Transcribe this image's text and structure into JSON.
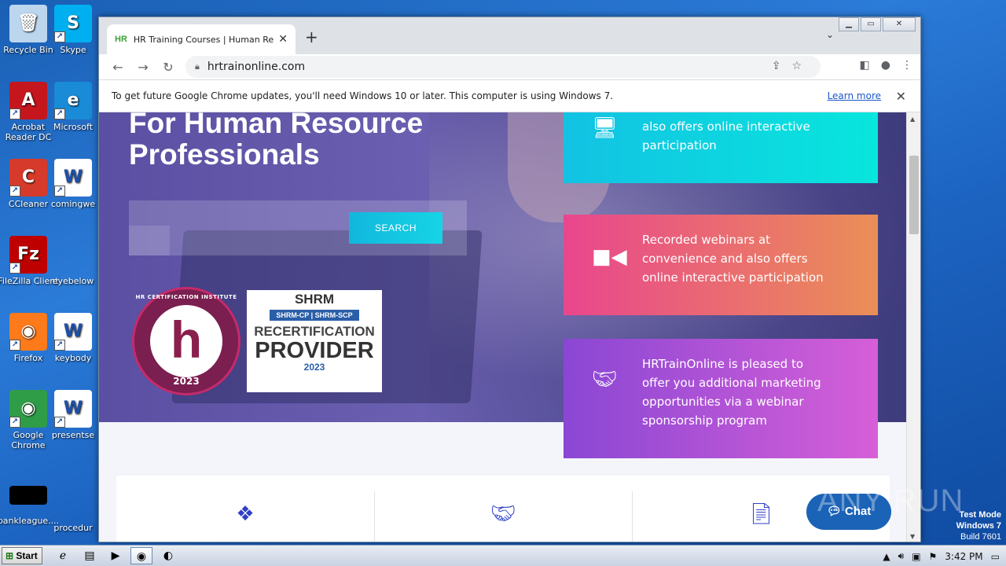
{
  "desktop": {
    "icons": [
      {
        "label": "Recycle Bin",
        "icon": "recycle-bin-icon"
      },
      {
        "label": "Skype",
        "icon": "skype-icon"
      },
      {
        "label": "Acrobat Reader DC",
        "icon": "acrobat-icon"
      },
      {
        "label": "Microsoft",
        "icon": "edge-icon"
      },
      {
        "label": "CCleaner",
        "icon": "ccleaner-icon"
      },
      {
        "label": "comingwe",
        "icon": "word-doc-icon"
      },
      {
        "label": "FileZilla Client",
        "icon": "filezilla-icon"
      },
      {
        "label": "eyebelow",
        "icon": "blank-file-icon"
      },
      {
        "label": "Firefox",
        "icon": "firefox-icon"
      },
      {
        "label": "keybody",
        "icon": "word-doc-icon"
      },
      {
        "label": "Google Chrome",
        "icon": "chrome-icon"
      },
      {
        "label": "presentse",
        "icon": "word-doc-icon"
      },
      {
        "label": "bankleague....",
        "icon": "black-file-icon"
      },
      {
        "label": "procedur",
        "icon": "blank-file-icon"
      }
    ]
  },
  "browser": {
    "tab": {
      "favicon": "HR",
      "title": "HR Training Courses | Human Resou"
    },
    "url": "hrtrainonline.com",
    "infobar": {
      "message": "To get future Google Chrome updates, you'll need Windows 10 or later. This computer is using Windows 7.",
      "link": "Learn more"
    }
  },
  "page": {
    "hero_title_line1": "For Human Resource",
    "hero_title_line2": "Professionals",
    "search_button": "SEARCH",
    "badge_hrci": {
      "top": "HR CERTIFICATION INSTITUTE",
      "letter": "h",
      "year": "2023"
    },
    "badge_shrm": {
      "title": "SHRM",
      "sub": "SHRM-CP | SHRM-SCP",
      "line1": "RECERTIFICATION",
      "line2": "PROVIDER",
      "year": "2023"
    },
    "cards": [
      {
        "text": "also offers online interactive participation",
        "icon": "monitor-icon"
      },
      {
        "text": "Recorded webinars at convenience and also offers online interactive participation",
        "icon": "video-camera-icon"
      },
      {
        "text": "HRTrainOnline is pleased to offer you additional marketing opportunities via a webinar sponsorship program",
        "icon": "handshake-icon"
      }
    ],
    "chat_label": "Chat"
  },
  "watermark": "ANY RUN",
  "testmode": {
    "line1": "Test Mode",
    "line2": "Windows 7",
    "line3": "Build 7601"
  },
  "taskbar": {
    "start": "Start",
    "clock": "3:42 PM"
  },
  "colors": {
    "hero": "#5a4fa2",
    "card1": "#13c2e3",
    "card2": "#e9468d",
    "card3": "#8a47d4",
    "chat": "#1b63b6",
    "search": "#12b7dc"
  }
}
